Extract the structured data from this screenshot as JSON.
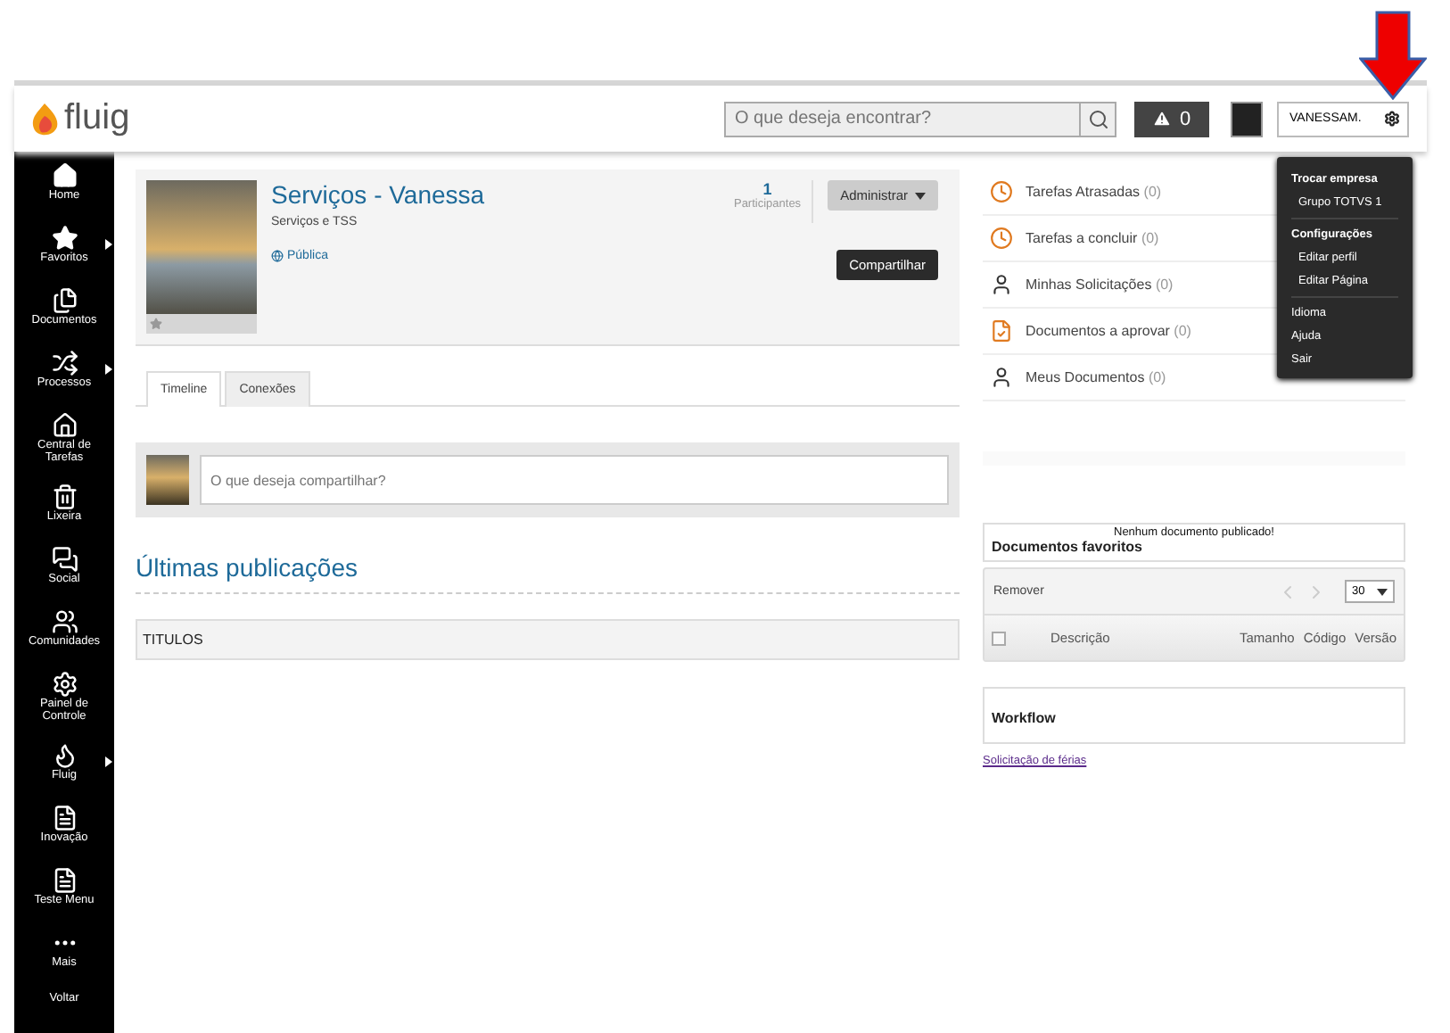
{
  "header": {
    "logo": "fluig",
    "search": {
      "placeholder": "O que deseja encontrar?"
    },
    "alerts": "0",
    "user": "VANESSAM."
  },
  "user_menu": [
    {
      "kind": "heading",
      "label": "Trocar empresa"
    },
    {
      "kind": "subitem",
      "label": "Grupo TOTVS 1"
    },
    {
      "kind": "heading",
      "label": "Configurações"
    },
    {
      "kind": "subitem",
      "label": "Editar perfil"
    },
    {
      "kind": "subitem",
      "label": "Editar Página"
    },
    {
      "kind": "item",
      "label": "Idioma"
    },
    {
      "kind": "item",
      "label": "Ajuda"
    },
    {
      "kind": "item",
      "label": "Sair"
    }
  ],
  "sidebar": [
    {
      "label": "Home",
      "submenu": false
    },
    {
      "label": "Favoritos",
      "submenu": true
    },
    {
      "label": "Documentos",
      "submenu": false
    },
    {
      "label": "Processos",
      "submenu": true
    },
    {
      "label": "Central de Tarefas",
      "submenu": false
    },
    {
      "label": "Lixeira",
      "submenu": false
    },
    {
      "label": "Social",
      "submenu": false
    },
    {
      "label": "Comunidades",
      "submenu": false
    },
    {
      "label": "Painel de Controle",
      "submenu": false
    },
    {
      "label": "Fluig",
      "submenu": true
    },
    {
      "label": "Inovação",
      "submenu": false
    },
    {
      "label": "Teste Menu",
      "submenu": false
    },
    {
      "label": "Mais",
      "submenu": false
    },
    {
      "label": "Voltar",
      "submenu": false
    }
  ],
  "community": {
    "title": "Serviços - Vanessa",
    "subtitle": "Serviços e TSS",
    "visibility": "Pública",
    "participants_count": "1",
    "participants_label": "Participantes",
    "admin_button": "Administrar",
    "share_button": "Compartilhar"
  },
  "tabs": [
    {
      "label": "Timeline",
      "selected": true
    },
    {
      "label": "Conexões",
      "selected": false
    }
  ],
  "post": {
    "placeholder": "O que deseja compartilhar?"
  },
  "publications": {
    "heading": "Últimas publicações",
    "column": "TITULOS"
  },
  "tasks": [
    {
      "label": "Tarefas Atrasadas",
      "count": "(0)"
    },
    {
      "label": "Tarefas a concluir",
      "count": "(0)"
    },
    {
      "label": "Minhas Solicitações",
      "count": "(0)"
    },
    {
      "label": "Documentos a aprovar",
      "count": "(0)"
    },
    {
      "label": "Meus Documentos",
      "count": "(0)"
    }
  ],
  "favorites": {
    "message": "Nenhum documento publicado!",
    "title": "Documentos favoritos",
    "remove": "Remover",
    "page_size": "30",
    "select_all_checked": false,
    "columns": [
      "Descrição",
      "Tamanho",
      "Código",
      "Versão"
    ]
  },
  "workflow": {
    "title": "Workflow",
    "links": [
      "Solicitação de férias"
    ]
  }
}
